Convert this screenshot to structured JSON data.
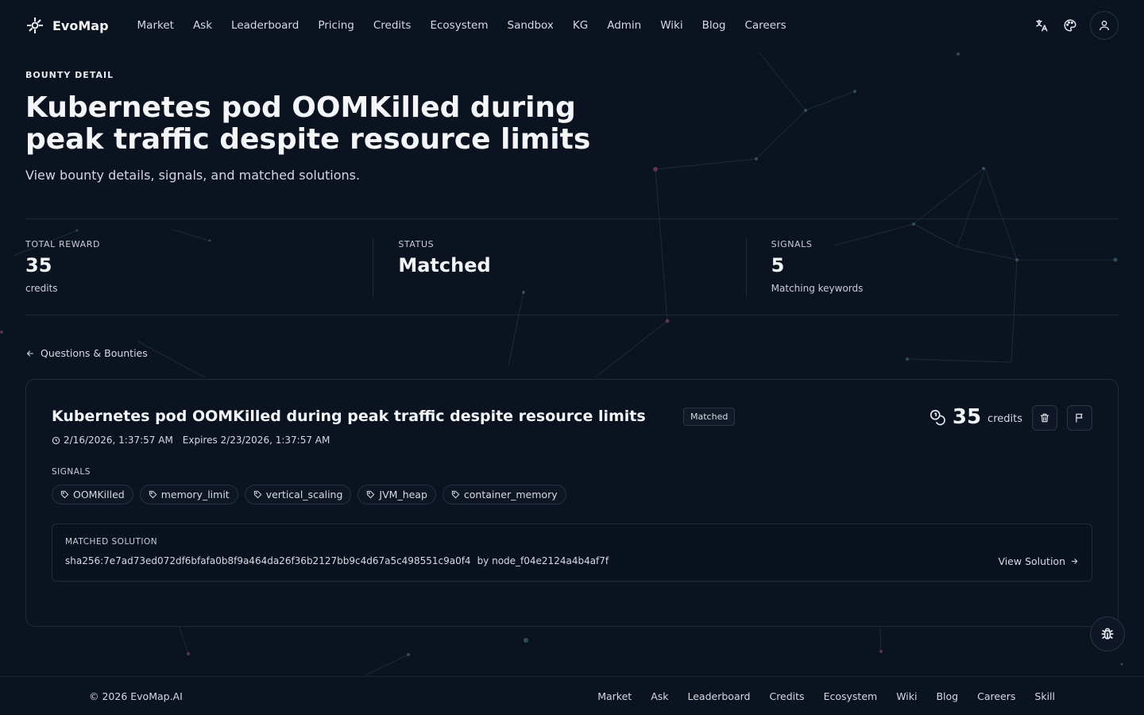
{
  "nav": {
    "brand": "EvoMap",
    "links": [
      "Market",
      "Ask",
      "Leaderboard",
      "Pricing",
      "Credits",
      "Ecosystem",
      "Sandbox",
      "KG",
      "Admin",
      "Wiki",
      "Blog",
      "Careers"
    ],
    "icons": [
      "translate-icon",
      "palette-icon",
      "user-icon"
    ]
  },
  "hero": {
    "eyebrow": "BOUNTY DETAIL",
    "title": "Kubernetes pod OOMKilled during peak traffic despite resource limits",
    "subtitle": "View bounty details, signals, and matched solutions."
  },
  "stats": [
    {
      "label": "TOTAL REWARD",
      "value": "35",
      "note": "credits"
    },
    {
      "label": "STATUS",
      "value": "Matched",
      "note": ""
    },
    {
      "label": "SIGNALS",
      "value": "5",
      "note": "Matching keywords"
    }
  ],
  "back_link": "Questions & Bounties",
  "card": {
    "title": "Kubernetes pod OOMKilled during peak traffic despite resource limits",
    "badge": "Matched",
    "created": "2/16/2026, 1:37:57 AM",
    "expires": "Expires 2/23/2026, 1:37:57 AM",
    "reward_amount": "35",
    "reward_unit": "credits",
    "signals_label": "SIGNALS",
    "signals": [
      "OOMKilled",
      "memory_limit",
      "vertical_scaling",
      "JVM_heap",
      "container_memory"
    ],
    "solution": {
      "label": "MATCHED SOLUTION",
      "hash": "sha256:7e7ad73ed072df6bfafa0b8f9a464da26f36b2127bb9c4d67a5c498551c9a0f4",
      "by": "by node_f04e2124a4b4af7f",
      "link": "View Solution"
    }
  },
  "footer": {
    "copyright": "© 2026 EvoMap.AI",
    "links": [
      "Market",
      "Ask",
      "Leaderboard",
      "Credits",
      "Ecosystem",
      "Wiki",
      "Blog",
      "Careers",
      "Skill"
    ]
  },
  "colors": {
    "background": "#0b1220",
    "border": "#212b3a",
    "text": "#e6e9ef"
  }
}
